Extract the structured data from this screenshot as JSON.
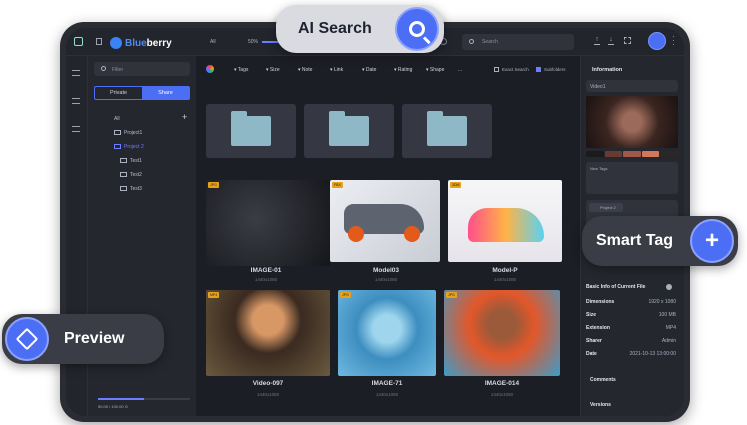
{
  "app": {
    "brand_part1": "Blue",
    "brand_part2": "berry"
  },
  "topbar": {
    "all_label": "All",
    "zoom": "50%",
    "search_placeholder": "Search"
  },
  "sidebar": {
    "filter_placeholder": "Filter",
    "tabs": [
      "Private",
      "Share"
    ],
    "tree": [
      {
        "label": "All"
      },
      {
        "label": "Project1"
      },
      {
        "label": "Project 2"
      },
      {
        "label": "Test1"
      },
      {
        "label": "Test2"
      },
      {
        "label": "Test3"
      }
    ],
    "storage_text": "50.00 / 100.00 G",
    "storage_fraction": 0.5
  },
  "filters": [
    "Tags",
    "Size",
    "Note",
    "Link",
    "Date",
    "Rating",
    "Shape",
    "..."
  ],
  "filter_options": {
    "exact": "Exact Search",
    "subfolders": "Subfolders"
  },
  "grid": [
    {
      "title": "IMAGE-01",
      "dims": "1440x1080",
      "badge": "JPG"
    },
    {
      "title": "Model03",
      "dims": "1440x1080",
      "badge": "FBX"
    },
    {
      "title": "Model-P",
      "dims": "1440x1080",
      "badge": "3DM"
    },
    {
      "title": "Video-097",
      "dims": "1440x1080",
      "badge": "MP4"
    },
    {
      "title": "IMAGE-71",
      "dims": "1440x1080",
      "badge": "JPG"
    },
    {
      "title": "IMAGE-014",
      "dims": "1440x1080",
      "badge": "JPG"
    }
  ],
  "right_panel": {
    "header": "Information",
    "name": "Video1",
    "tags_placeholder": "New Tags",
    "folder": "Project 2",
    "basic_title": "Basic Info of Current File",
    "rows": [
      {
        "k": "Dimensions",
        "v": "1920 x 1080"
      },
      {
        "k": "Size",
        "v": "100 MB"
      },
      {
        "k": "Extension",
        "v": "MP4"
      },
      {
        "k": "Sharer",
        "v": "Admin"
      },
      {
        "k": "Date",
        "v": "2021-10-13 13:00:00"
      }
    ],
    "comments": "Comments",
    "versions": "Versions",
    "swatches": [
      "#1c1a1c",
      "#6b3a2e",
      "#a15846",
      "#d47658",
      "#2c2628"
    ]
  },
  "callouts": {
    "ai_search": "AI Search",
    "smart_tag": "Smart Tag",
    "preview": "Preview"
  },
  "colors": {
    "accent": "#4c6ef5",
    "bg": "#1e2027"
  }
}
